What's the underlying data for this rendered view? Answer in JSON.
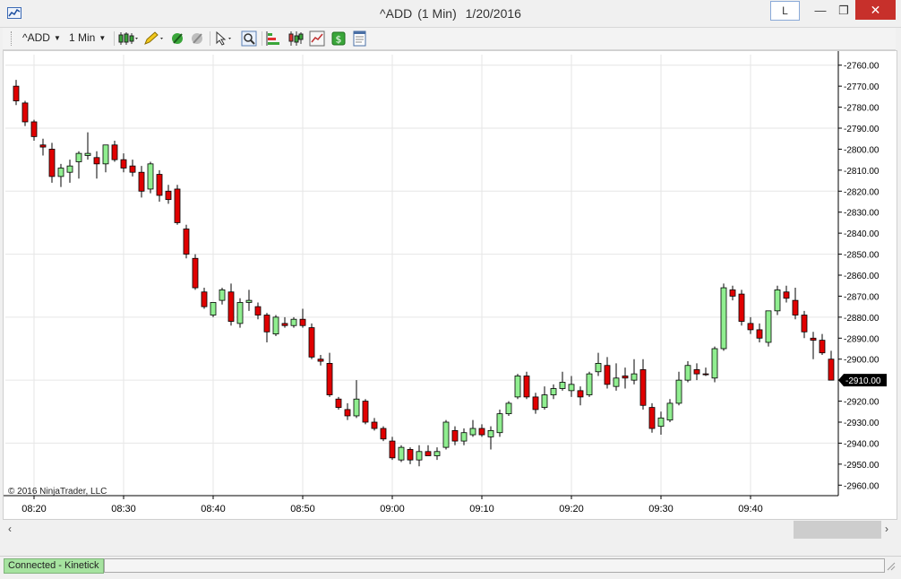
{
  "window": {
    "title_symbol": "^ADD",
    "title_interval": "(1 Min)",
    "title_date": "1/20/2016",
    "tab_label": "L",
    "minimize": "—",
    "maximize": "❐",
    "close": "✕"
  },
  "toolbar": {
    "instrument": "^ADD",
    "interval": "1 Min",
    "icons": [
      "candlestick-style-icon",
      "drawing-pencil-icon",
      "indicator-icon",
      "strategy-icon",
      "pointer-icon",
      "zoom-icon",
      "bar-chart-icon",
      "candles-icon",
      "data-box-icon",
      "dollar-icon",
      "properties-icon"
    ]
  },
  "chart_data": {
    "type": "candlestick",
    "title": "",
    "copyright": "© 2016 NinjaTrader, LLC",
    "x_ticks": [
      "08:20",
      "08:30",
      "08:40",
      "08:50",
      "09:00",
      "09:10",
      "09:20",
      "09:30",
      "09:40"
    ],
    "y_ticks": [
      "-2760.00",
      "-2770.00",
      "-2780.00",
      "-2790.00",
      "-2800.00",
      "-2810.00",
      "-2820.00",
      "-2830.00",
      "-2840.00",
      "-2850.00",
      "-2860.00",
      "-2870.00",
      "-2880.00",
      "-2890.00",
      "-2900.00",
      "-2910.00",
      "-2920.00",
      "-2930.00",
      "-2940.00",
      "-2950.00",
      "-2960.00"
    ],
    "ylim": [
      -2965,
      -2755
    ],
    "last_price_label": "-2910.00",
    "last_price": -2910,
    "colors": {
      "up": "#90ee90",
      "down": "#e00000",
      "grid": "#e6e6e6",
      "wick": "#000000"
    },
    "candles": [
      {
        "t": "08:18",
        "o": -2770,
        "h": -2767,
        "l": -2779,
        "c": -2777
      },
      {
        "t": "08:19",
        "o": -2778,
        "h": -2777,
        "l": -2789,
        "c": -2787
      },
      {
        "t": "08:20",
        "o": -2787,
        "h": -2786,
        "l": -2796,
        "c": -2794
      },
      {
        "t": "08:21",
        "o": -2798,
        "h": -2795,
        "l": -2803,
        "c": -2799
      },
      {
        "t": "08:22",
        "o": -2800,
        "h": -2797,
        "l": -2816,
        "c": -2813
      },
      {
        "t": "08:23",
        "o": -2813,
        "h": -2807,
        "l": -2818,
        "c": -2809
      },
      {
        "t": "08:24",
        "o": -2811,
        "h": -2805,
        "l": -2816,
        "c": -2808
      },
      {
        "t": "08:25",
        "o": -2806,
        "h": -2801,
        "l": -2814,
        "c": -2802
      },
      {
        "t": "08:26",
        "o": -2803,
        "h": -2792,
        "l": -2805,
        "c": -2802
      },
      {
        "t": "08:27",
        "o": -2804,
        "h": -2801,
        "l": -2814,
        "c": -2807
      },
      {
        "t": "08:28",
        "o": -2807,
        "h": -2798,
        "l": -2811,
        "c": -2798
      },
      {
        "t": "08:29",
        "o": -2798,
        "h": -2796,
        "l": -2806,
        "c": -2805
      },
      {
        "t": "08:30",
        "o": -2805,
        "h": -2802,
        "l": -2811,
        "c": -2809
      },
      {
        "t": "08:31",
        "o": -2808,
        "h": -2805,
        "l": -2813,
        "c": -2811
      },
      {
        "t": "08:32",
        "o": -2811,
        "h": -2808,
        "l": -2823,
        "c": -2820
      },
      {
        "t": "08:33",
        "o": -2819,
        "h": -2806,
        "l": -2821,
        "c": -2807
      },
      {
        "t": "08:34",
        "o": -2812,
        "h": -2810,
        "l": -2825,
        "c": -2822
      },
      {
        "t": "08:35",
        "o": -2820,
        "h": -2817,
        "l": -2826,
        "c": -2824
      },
      {
        "t": "08:36",
        "o": -2819,
        "h": -2817,
        "l": -2836,
        "c": -2835
      },
      {
        "t": "08:37",
        "o": -2838,
        "h": -2836,
        "l": -2852,
        "c": -2850
      },
      {
        "t": "08:38",
        "o": -2852,
        "h": -2850,
        "l": -2867,
        "c": -2866
      },
      {
        "t": "08:39",
        "o": -2868,
        "h": -2866,
        "l": -2876,
        "c": -2875
      },
      {
        "t": "08:40",
        "o": -2879,
        "h": -2873,
        "l": -2880,
        "c": -2873
      },
      {
        "t": "08:41",
        "o": -2872,
        "h": -2866,
        "l": -2874,
        "c": -2867
      },
      {
        "t": "08:42",
        "o": -2868,
        "h": -2864,
        "l": -2884,
        "c": -2882
      },
      {
        "t": "08:43",
        "o": -2883,
        "h": -2871,
        "l": -2885,
        "c": -2873
      },
      {
        "t": "08:44",
        "o": -2873,
        "h": -2867,
        "l": -2877,
        "c": -2872
      },
      {
        "t": "08:45",
        "o": -2875,
        "h": -2873,
        "l": -2881,
        "c": -2879
      },
      {
        "t": "08:46",
        "o": -2879,
        "h": -2878,
        "l": -2892,
        "c": -2887
      },
      {
        "t": "08:47",
        "o": -2888,
        "h": -2879,
        "l": -2889,
        "c": -2880
      },
      {
        "t": "08:48",
        "o": -2883,
        "h": -2880,
        "l": -2885,
        "c": -2884
      },
      {
        "t": "08:49",
        "o": -2884,
        "h": -2880,
        "l": -2885,
        "c": -2881
      },
      {
        "t": "08:50",
        "o": -2881,
        "h": -2876,
        "l": -2885,
        "c": -2884
      },
      {
        "t": "08:51",
        "o": -2885,
        "h": -2883,
        "l": -2900,
        "c": -2899
      },
      {
        "t": "08:52",
        "o": -2900,
        "h": -2898,
        "l": -2903,
        "c": -2901
      },
      {
        "t": "08:53",
        "o": -2902,
        "h": -2897,
        "l": -2918,
        "c": -2917
      },
      {
        "t": "08:54",
        "o": -2919,
        "h": -2918,
        "l": -2924,
        "c": -2923
      },
      {
        "t": "08:55",
        "o": -2924,
        "h": -2921,
        "l": -2929,
        "c": -2927
      },
      {
        "t": "08:56",
        "o": -2927,
        "h": -2910,
        "l": -2928,
        "c": -2919
      },
      {
        "t": "08:57",
        "o": -2920,
        "h": -2919,
        "l": -2931,
        "c": -2930
      },
      {
        "t": "08:58",
        "o": -2930,
        "h": -2928,
        "l": -2934,
        "c": -2933
      },
      {
        "t": "08:59",
        "o": -2933,
        "h": -2932,
        "l": -2939,
        "c": -2938
      },
      {
        "t": "09:00",
        "o": -2939,
        "h": -2937,
        "l": -2948,
        "c": -2947
      },
      {
        "t": "09:01",
        "o": -2948,
        "h": -2941,
        "l": -2949,
        "c": -2942
      },
      {
        "t": "09:02",
        "o": -2943,
        "h": -2942,
        "l": -2950,
        "c": -2948
      },
      {
        "t": "09:03",
        "o": -2948,
        "h": -2941,
        "l": -2951,
        "c": -2944
      },
      {
        "t": "09:04",
        "o": -2944,
        "h": -2941,
        "l": -2946,
        "c": -2946
      },
      {
        "t": "09:05",
        "o": -2946,
        "h": -2942,
        "l": -2948,
        "c": -2944
      },
      {
        "t": "09:06",
        "o": -2942,
        "h": -2929,
        "l": -2943,
        "c": -2930
      },
      {
        "t": "09:07",
        "o": -2934,
        "h": -2932,
        "l": -2941,
        "c": -2939
      },
      {
        "t": "09:08",
        "o": -2939,
        "h": -2933,
        "l": -2941,
        "c": -2935
      },
      {
        "t": "09:09",
        "o": -2936,
        "h": -2929,
        "l": -2937,
        "c": -2933
      },
      {
        "t": "09:10",
        "o": -2933,
        "h": -2931,
        "l": -2937,
        "c": -2936
      },
      {
        "t": "09:11",
        "o": -2937,
        "h": -2932,
        "l": -2943,
        "c": -2934
      },
      {
        "t": "09:12",
        "o": -2935,
        "h": -2924,
        "l": -2937,
        "c": -2926
      },
      {
        "t": "09:13",
        "o": -2926,
        "h": -2920,
        "l": -2927,
        "c": -2921
      },
      {
        "t": "09:14",
        "o": -2918,
        "h": -2907,
        "l": -2919,
        "c": -2908
      },
      {
        "t": "09:15",
        "o": -2908,
        "h": -2906,
        "l": -2919,
        "c": -2918
      },
      {
        "t": "09:16",
        "o": -2918,
        "h": -2916,
        "l": -2926,
        "c": -2924
      },
      {
        "t": "09:17",
        "o": -2923,
        "h": -2913,
        "l": -2924,
        "c": -2917
      },
      {
        "t": "09:18",
        "o": -2917,
        "h": -2912,
        "l": -2919,
        "c": -2914
      },
      {
        "t": "09:19",
        "o": -2914,
        "h": -2906,
        "l": -2915,
        "c": -2911
      },
      {
        "t": "09:20",
        "o": -2915,
        "h": -2908,
        "l": -2918,
        "c": -2912
      },
      {
        "t": "09:21",
        "o": -2915,
        "h": -2913,
        "l": -2922,
        "c": -2918
      },
      {
        "t": "09:22",
        "o": -2917,
        "h": -2906,
        "l": -2918,
        "c": -2907
      },
      {
        "t": "09:23",
        "o": -2906,
        "h": -2897,
        "l": -2908,
        "c": -2902
      },
      {
        "t": "09:24",
        "o": -2903,
        "h": -2899,
        "l": -2914,
        "c": -2912
      },
      {
        "t": "09:25",
        "o": -2913,
        "h": -2902,
        "l": -2915,
        "c": -2909
      },
      {
        "t": "09:26",
        "o": -2908,
        "h": -2904,
        "l": -2914,
        "c": -2909
      },
      {
        "t": "09:27",
        "o": -2910,
        "h": -2900,
        "l": -2912,
        "c": -2907
      },
      {
        "t": "09:28",
        "o": -2905,
        "h": -2900,
        "l": -2924,
        "c": -2922
      },
      {
        "t": "09:29",
        "o": -2923,
        "h": -2921,
        "l": -2935,
        "c": -2933
      },
      {
        "t": "09:30",
        "o": -2932,
        "h": -2925,
        "l": -2936,
        "c": -2928
      },
      {
        "t": "09:31",
        "o": -2929,
        "h": -2919,
        "l": -2930,
        "c": -2921
      },
      {
        "t": "09:32",
        "o": -2921,
        "h": -2906,
        "l": -2922,
        "c": -2910
      },
      {
        "t": "09:33",
        "o": -2910,
        "h": -2901,
        "l": -2911,
        "c": -2903
      },
      {
        "t": "09:34",
        "o": -2905,
        "h": -2902,
        "l": -2910,
        "c": -2907
      },
      {
        "t": "09:35",
        "o": -2907,
        "h": -2904,
        "l": -2908,
        "c": -2907
      },
      {
        "t": "09:36",
        "o": -2909,
        "h": -2894,
        "l": -2911,
        "c": -2895
      },
      {
        "t": "09:37",
        "o": -2895,
        "h": -2864,
        "l": -2896,
        "c": -2866
      },
      {
        "t": "09:38",
        "o": -2867,
        "h": -2865,
        "l": -2872,
        "c": -2870
      },
      {
        "t": "09:39",
        "o": -2869,
        "h": -2867,
        "l": -2884,
        "c": -2882
      },
      {
        "t": "09:40",
        "o": -2883,
        "h": -2880,
        "l": -2888,
        "c": -2886
      },
      {
        "t": "09:41",
        "o": -2886,
        "h": -2883,
        "l": -2892,
        "c": -2890
      },
      {
        "t": "09:42",
        "o": -2892,
        "h": -2877,
        "l": -2894,
        "c": -2877
      },
      {
        "t": "09:43",
        "o": -2877,
        "h": -2865,
        "l": -2879,
        "c": -2867
      },
      {
        "t": "09:44",
        "o": -2868,
        "h": -2865,
        "l": -2873,
        "c": -2871
      },
      {
        "t": "09:45",
        "o": -2872,
        "h": -2866,
        "l": -2881,
        "c": -2879
      },
      {
        "t": "09:46",
        "o": -2879,
        "h": -2877,
        "l": -2890,
        "c": -2887
      },
      {
        "t": "09:47",
        "o": -2890,
        "h": -2887,
        "l": -2900,
        "c": -2891
      },
      {
        "t": "09:48",
        "o": -2891,
        "h": -2888,
        "l": -2898,
        "c": -2897
      },
      {
        "t": "09:49",
        "o": -2900,
        "h": -2896,
        "l": -2910,
        "c": -2910
      }
    ]
  },
  "status": {
    "connection": "Connected - Kinetick"
  }
}
